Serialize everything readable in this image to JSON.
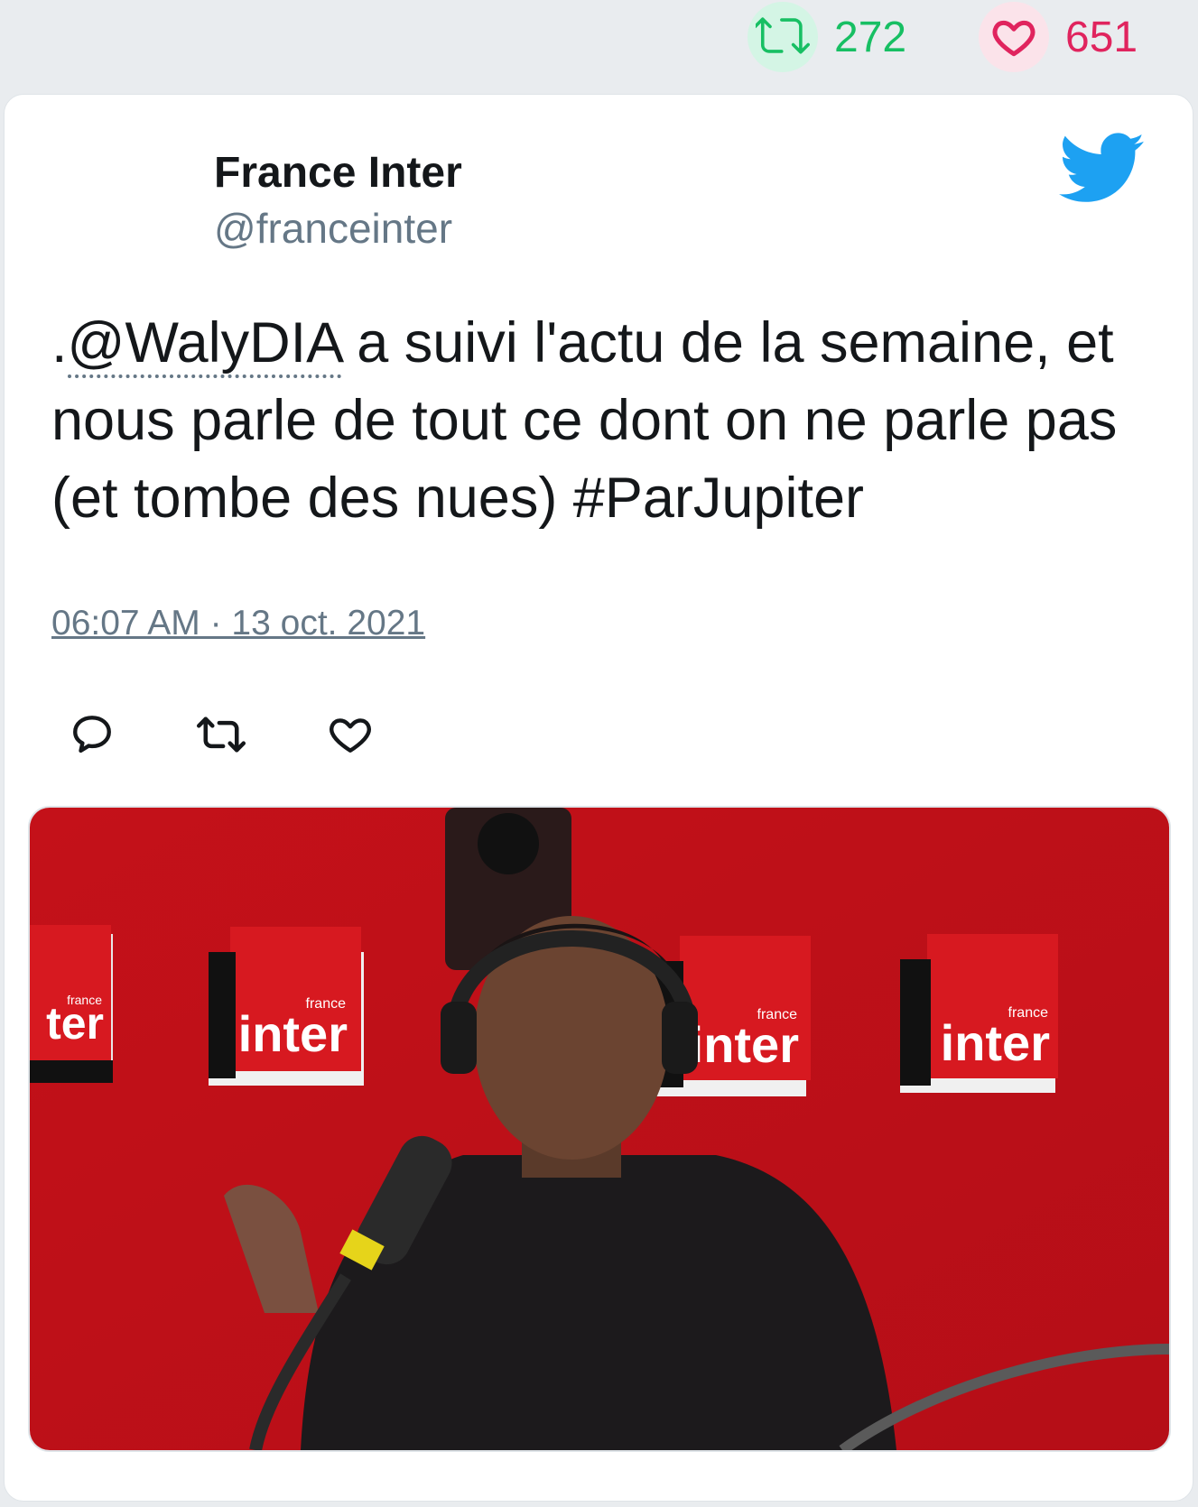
{
  "stats": {
    "retweets": "272",
    "likes": "651"
  },
  "tweet": {
    "author_name": "France Inter",
    "author_handle": "@franceinter",
    "text_prefix": ".",
    "mention": "@WalyDIA",
    "text_body": " a suivi l'actu de la semaine, et nous parle de tout ce dont on ne parle pas (et tombe des nues) #ParJupiter",
    "timestamp": "06:07 AM · 13 oct. 2021"
  },
  "media": {
    "logo_small_text": "france",
    "logo_big_text": "inter",
    "logo_cut_text": "ter"
  },
  "colors": {
    "retweet": "#17bf63",
    "like": "#e0245e",
    "twitter_blue": "#1da1f2",
    "backdrop_red": "#c8101a"
  }
}
